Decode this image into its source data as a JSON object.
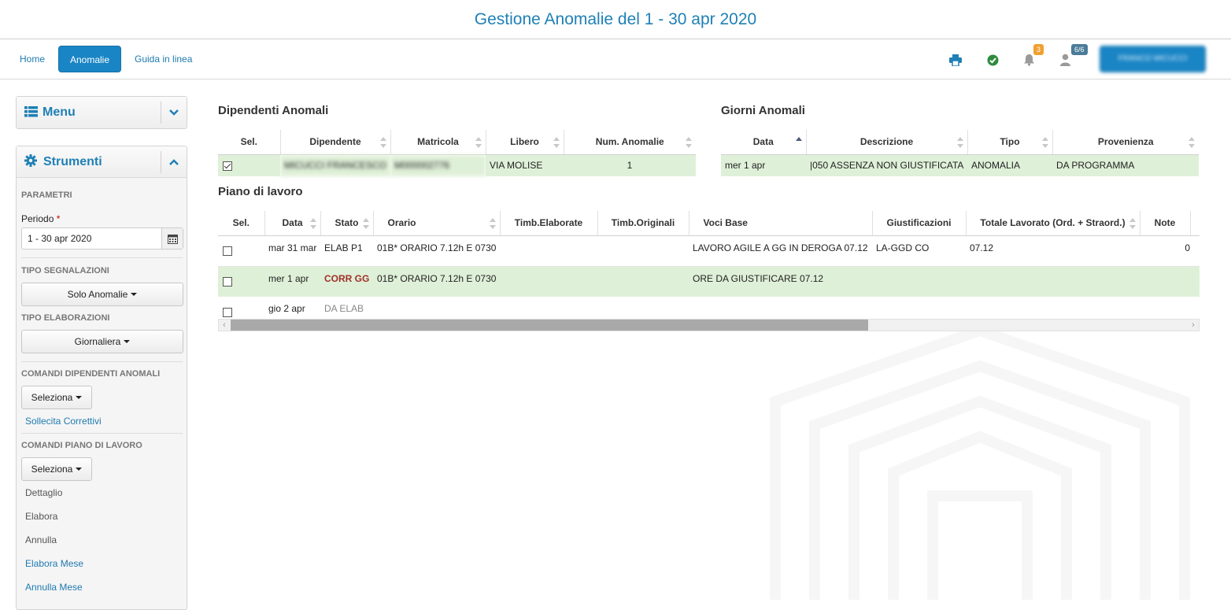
{
  "title": "Gestione Anomalie del 1 - 30 apr 2020",
  "nav": {
    "home": "Home",
    "anomalie": "Anomalie",
    "guida": "Guida in linea",
    "notifications_count": "3",
    "users_count": "6/6",
    "user_name": "FRANCO MICUCCI"
  },
  "sidebar": {
    "menu_label": "Menu",
    "strumenti_label": "Strumenti",
    "parametri": "PARAMETRI",
    "periodo_label": "Periodo",
    "periodo_required": "*",
    "periodo_value": "1 - 30 apr 2020",
    "tipo_segnalazioni": "TIPO SEGNALAZIONI",
    "solo_anomalie": "Solo Anomalie",
    "tipo_elaborazioni": "TIPO ELABORAZIONI",
    "giornaliera": "Giornaliera",
    "comandi_dip": "COMANDI DIPENDENTI ANOMALI",
    "seleziona1": "Seleziona",
    "sollecita": "Sollecita Correttivi",
    "comandi_piano": "COMANDI PIANO DI LAVORO",
    "seleziona2": "Seleziona",
    "dettaglio": "Dettaglio",
    "elabora": "Elabora",
    "annulla": "Annulla",
    "elabora_mese": "Elabora Mese",
    "annulla_mese": "Annulla Mese"
  },
  "dipendenti": {
    "title": "Dipendenti Anomali",
    "headers": [
      "Sel.",
      "Dipendente",
      "Matricola",
      "Libero",
      "Num. Anomalie"
    ],
    "row": {
      "dipendente": "MICUCCI FRANCESCO",
      "matricola": "M000002776",
      "libero": "VIA MOLISE",
      "num": "1"
    }
  },
  "giorni": {
    "title": "Giorni Anomali",
    "headers": [
      "Data",
      "Descrizione",
      "Tipo",
      "Provenienza"
    ],
    "row": {
      "data": "mer 1 apr",
      "descrizione": "|050 ASSENZA NON GIUSTIFICATA",
      "tipo": "ANOMALIA",
      "provenienza": "DA PROGRAMMA"
    }
  },
  "piano": {
    "title": "Piano di lavoro",
    "headers": [
      "Sel.",
      "Data",
      "Stato",
      "Orario",
      "Timb.Elaborate",
      "Timb.Originali",
      "Voci Base",
      "Giustificazioni",
      "Totale Lavorato (Ord. + Straord.)",
      "Note"
    ],
    "rows": [
      {
        "data": "mar 31 mar",
        "stato": "ELAB P1",
        "orario": "01B* ORARIO 7.12h E 0730",
        "voci": "LAVORO AGILE A GG IN DEROGA 07.12",
        "giust": "LA-GGD CO",
        "totale": "07.12",
        "note": "0"
      },
      {
        "data": "mer 1 apr",
        "stato": "CORR GG",
        "orario": "01B* ORARIO 7.12h E 0730",
        "voci": "ORE DA GIUSTIFICARE 07.12",
        "giust": "",
        "totale": "",
        "note": ""
      },
      {
        "data": "gio 2 apr",
        "stato": "DA ELAB",
        "orario": "",
        "voci": "",
        "giust": "",
        "totale": "",
        "note": ""
      }
    ]
  },
  "colors": {
    "accent": "#1a85c5",
    "title": "#1f80b5",
    "row_highlight": "#dff0d8",
    "corr": "#a0302a",
    "badge_orange": "#f0a030",
    "badge_blue": "#4a7b99"
  }
}
